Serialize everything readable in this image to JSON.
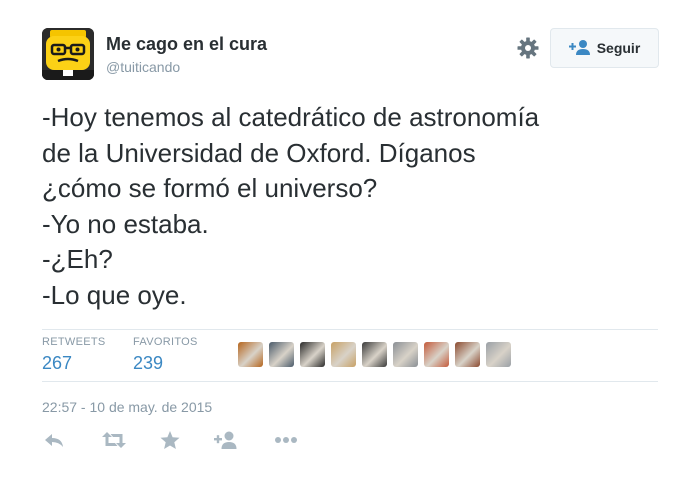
{
  "author": {
    "name": "Me cago en el cura",
    "handle": "@tuiticando"
  },
  "follow_button": {
    "label": "Seguir"
  },
  "tweet": {
    "lines": [
      "-Hoy tenemos al catedrático de astronomía",
      "de la Universidad de Oxford. Díganos",
      "¿cómo se formó el universo?",
      "-Yo no estaba.",
      "-¿Eh?",
      "-Lo que oye."
    ]
  },
  "stats": {
    "retweets_label": "RETWEETS",
    "retweets_count": "267",
    "favorites_label": "FAVORITOS",
    "favorites_count": "239"
  },
  "favoriters": [
    {
      "color": "#b5651d"
    },
    {
      "color": "#4a5a6a"
    },
    {
      "color": "#2a2a2a"
    },
    {
      "color": "#c8a165"
    },
    {
      "color": "#3a3a3a"
    },
    {
      "color": "#8a8f95"
    },
    {
      "color": "#c45a3a"
    },
    {
      "color": "#8b4a2f"
    },
    {
      "color": "#9aa0a6"
    }
  ],
  "timestamp": "22:57 - 10 de may. de 2015",
  "icons": {
    "settings": "gear-icon",
    "follow": "add-user-icon",
    "reply": "reply-icon",
    "retweet": "retweet-icon",
    "favorite": "star-icon",
    "follow_action": "add-user-icon",
    "more": "more-icon"
  },
  "colors": {
    "link": "#3b88c3",
    "muted": "#8899a6",
    "text": "#292f33",
    "icon": "#aab8c2"
  }
}
